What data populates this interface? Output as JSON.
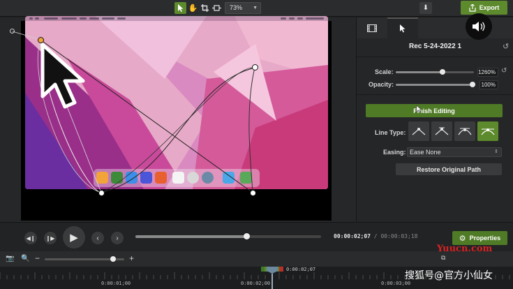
{
  "toolbar": {
    "zoom_value": "73%",
    "export_label": "Export"
  },
  "panel": {
    "clip_title": "Rec 5-24-2022 1",
    "scale_label": "Scale:",
    "scale_value": "1260%",
    "scale_fraction": 0.6,
    "opacity_label": "Opacity:",
    "opacity_value": "100%",
    "opacity_fraction": 1.0,
    "finish_label": "Finish Editing",
    "line_type_label": "Line Type:",
    "easing_label": "Easing:",
    "easing_value": "Ease None",
    "restore_label": "Restore Original Path"
  },
  "playback": {
    "time_current": "00:00:02;07",
    "time_total": "00:00:03;18",
    "progress_fraction": 0.6,
    "properties_label": "Properties"
  },
  "timeline": {
    "zoom_fraction": 0.86,
    "playhead_time": "0:00:02;07",
    "ruler_labels": [
      "0:00:01;00",
      "0:00:02;00",
      "0:00:03;00"
    ]
  },
  "watermarks": {
    "site": "Yuucn.com",
    "credit": "搜狐号@官方小仙女"
  },
  "colors": {
    "accent": "#5d8a2c",
    "background": "#1f2022"
  }
}
